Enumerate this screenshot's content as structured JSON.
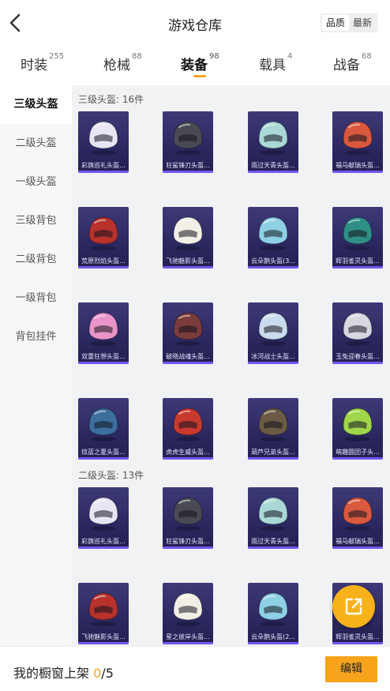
{
  "header": {
    "title": "游戏仓库",
    "sort_options": [
      "品质",
      "最新"
    ],
    "active_sort": 0
  },
  "tabs": [
    {
      "label": "时装",
      "count": "255"
    },
    {
      "label": "枪械",
      "count": "88"
    },
    {
      "label": "装备",
      "count": "98",
      "active": true
    },
    {
      "label": "载具",
      "count": "4"
    },
    {
      "label": "战备",
      "count": "68"
    }
  ],
  "sidebar": [
    "三级头盔",
    "二级头盔",
    "一级头盔",
    "三级背包",
    "二级背包",
    "一级背包",
    "背包挂件"
  ],
  "sections": [
    {
      "title": "三级头盔: 16件",
      "items": [
        "彩旗巡礼头盔...",
        "狂鲨锋刃头盔...",
        "雨过天青头盔...",
        "福马献瑞头盔...",
        "荒原烈焰头盔...",
        "飞驰魅影头盔...",
        "云朵鹅头盔(3...",
        "辉羽雀灵头盔...",
        "双重狂想头盔...",
        "破晓战魂头盔...",
        "冰河战士头盔...",
        "玉兔迎春头盔...",
        "炫蓝之夏头盔...",
        "虎虎生威头盔...",
        "葫芦兄弟头盔...",
        "萌趣圆团子头..."
      ]
    },
    {
      "title": "二级头盔: 13件",
      "items": [
        "彩旗巡礼头盔...",
        "狂鲨锋刃头盔...",
        "雨过天青头盔...",
        "福马献瑞头盔...",
        "飞驰魅影头盔...",
        "星之彼岸头盔...",
        "云朵鹅头盔(2...",
        "辉羽雀灵头盔..."
      ]
    }
  ],
  "bottom": {
    "shelf_label": "我的橱窗上架",
    "shelf_current": "0",
    "shelf_total": "/5",
    "edit_label": "编辑"
  },
  "colors": {
    "accent": "#f5a623",
    "card_bg": "#2b2860"
  },
  "icons": {
    "back": "chevron-left-icon",
    "share": "share-external-icon"
  }
}
